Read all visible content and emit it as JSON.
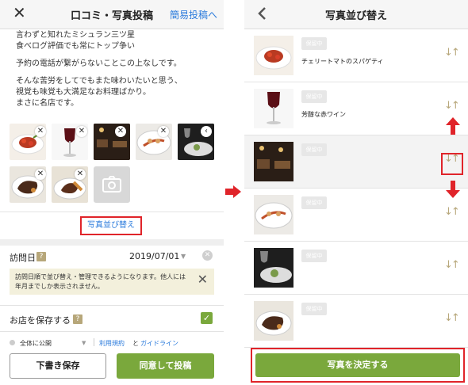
{
  "left_screen": {
    "nav": {
      "title": "口コミ・写真投稿",
      "link_label": "簡易投稿へ"
    },
    "review_lines": [
      "言わずと知れたミシュラン三ツ星",
      "食べログ評価でも常にトップ争い",
      "",
      "予約の電話が繋がらないことこの上なしです。",
      "",
      "そんな苦労をしてでもまた味わいたいと思う、",
      "視覚も味覚も大満足なお料理ばかり。",
      "まさに名店です。"
    ],
    "sort_photos_label": "写真並び替え",
    "visit_date": {
      "label": "訪問日",
      "help": "?",
      "value": "2019/07/01"
    },
    "notice": "訪問日順で並び替え・管理できるようになります。他人には年月までしか表示されません。",
    "save_store": {
      "label": "お店を保存する",
      "help": "?",
      "checked": true
    },
    "visibility": {
      "value": "全体に公開",
      "terms_link": "利用規約",
      "and": "と",
      "guideline_link": "ガイドライン"
    },
    "buttons": {
      "draft": "下書き保存",
      "post": "同意して投稿"
    }
  },
  "right_screen": {
    "nav": {
      "title": "写真並び替え"
    },
    "pending_badge": "保留中",
    "rows": [
      {
        "caption": "チェリートマトのスパゲティ",
        "image": "pasta"
      },
      {
        "caption": "芳醇な赤ワイン",
        "image": "wine"
      },
      {
        "caption": "",
        "image": "dining-room"
      },
      {
        "caption": "",
        "image": "plated-dish"
      },
      {
        "caption": "",
        "image": "wine-glass-plate"
      },
      {
        "caption": "",
        "image": "steak"
      }
    ],
    "confirm_button": "写真を決定する"
  },
  "colors": {
    "accent_green": "#7aa83c",
    "link_blue": "#2b7bdc",
    "highlight_red": "#e0242a",
    "handle_gold": "#b7a77a"
  }
}
